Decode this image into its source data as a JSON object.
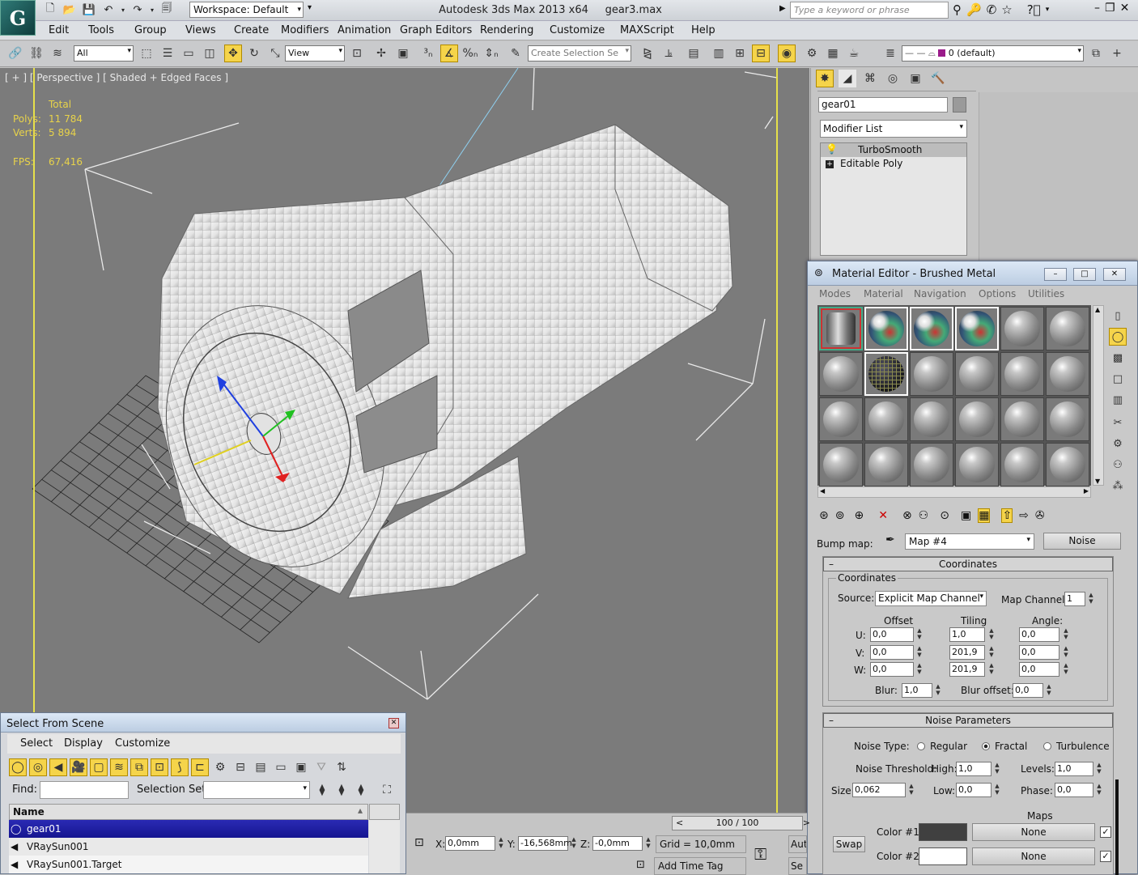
{
  "app": {
    "title": "Autodesk 3ds Max  2013 x64",
    "file": "gear3.max",
    "workspace": "Workspace: Default",
    "search_placeholder": "Type a keyword or phrase"
  },
  "menu": [
    "Edit",
    "Tools",
    "Group",
    "Views",
    "Create",
    "Modifiers",
    "Animation",
    "Graph Editors",
    "Rendering",
    "Customize",
    "MAXScript",
    "Help"
  ],
  "toolbar": {
    "filter": "All",
    "ref_coord": "View",
    "selection_set_placeholder": "Create Selection Se",
    "layer": "0 (default)"
  },
  "viewport": {
    "label": "[ + ] [ Perspective ] [ Shaded + Edged Faces ]",
    "stats": {
      "total_label": "Total",
      "polys_label": "Polys:",
      "polys": "11 784",
      "verts_label": "Verts:",
      "verts": "5 894",
      "fps_label": "FPS:",
      "fps": "67,416"
    }
  },
  "command_panel": {
    "object_name": "gear01",
    "modifier_list": "Modifier List",
    "stack": [
      "TurboSmooth",
      "Editable Poly"
    ]
  },
  "material_editor": {
    "title": "Material Editor - Brushed Metal",
    "menu": [
      "Modes",
      "Material",
      "Navigation",
      "Options",
      "Utilities"
    ],
    "bump_label": "Bump map:",
    "map_name": "Map #4",
    "map_type": "Noise",
    "coordinates": {
      "header": "Coordinates",
      "group": "Coordinates",
      "source_label": "Source:",
      "source": "Explicit Map Channel",
      "map_channel_label": "Map Channel:",
      "map_channel": "1",
      "offset_label": "Offset",
      "tiling_label": "Tiling",
      "angle_label": "Angle:",
      "u_label": "U:",
      "v_label": "V:",
      "w_label": "W:",
      "offset": [
        "0,0",
        "0,0",
        "0,0"
      ],
      "tiling": [
        "1,0",
        "201,9",
        "201,9"
      ],
      "angle": [
        "0,0",
        "0,0",
        "0,0"
      ],
      "blur_label": "Blur:",
      "blur": "1,0",
      "blur_offset_label": "Blur offset:",
      "blur_offset": "0,0"
    },
    "noise": {
      "header": "Noise Parameters",
      "type_label": "Noise Type:",
      "types": [
        "Regular",
        "Fractal",
        "Turbulence"
      ],
      "selected_type": "Fractal",
      "threshold_label": "Noise Threshold:",
      "high_label": "High:",
      "high": "1,0",
      "levels_label": "Levels:",
      "levels": "1,0",
      "size_label": "Size:",
      "size": "0,062",
      "low_label": "Low:",
      "low": "0,0",
      "phase_label": "Phase:",
      "phase": "0,0",
      "maps_label": "Maps",
      "swap": "Swap",
      "color1_label": "Color #1",
      "color1": "#404040",
      "map1": "None",
      "color2_label": "Color #2",
      "color2": "#ffffff",
      "map2": "None"
    }
  },
  "select_scene": {
    "title": "Select From Scene",
    "menu": [
      "Select",
      "Display",
      "Customize"
    ],
    "find_label": "Find:",
    "selection_set_label": "Selection Set:",
    "column": "Name",
    "rows": [
      "gear01",
      "VRaySun001",
      "VRaySun001.Target"
    ],
    "selected_row": "gear01"
  },
  "status": {
    "frame": "100 / 100",
    "x_label": "X:",
    "x": "0,0mm",
    "y_label": "Y:",
    "y": "-16,568mm",
    "z_label": "Z:",
    "z": "-0,0mm",
    "grid": "Grid = 10,0mm",
    "add_time_tag": "Add Time Tag",
    "auto": "Aut",
    "set": "Se"
  },
  "colors": {
    "accent_yellow": "#e6e04a",
    "selection_blue": "#1c1ca0",
    "viewport_bg": "#7b7b7b"
  }
}
